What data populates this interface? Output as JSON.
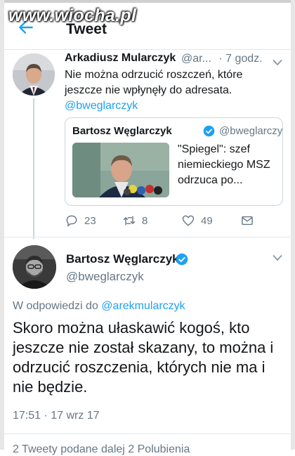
{
  "watermark": "www.wiocha.pl",
  "header": {
    "title": "Tweet",
    "back_icon": "arrow-left-icon"
  },
  "parent_tweet": {
    "name": "Arkadiusz Mularczyk",
    "handle": "@ar...",
    "time": "· 7 godz.",
    "text": "Nie można odrzucić roszczeń, które jeszcze nie wpłynęły do adresata.",
    "mention": "@bweglarczyk",
    "quote": {
      "name": "Bartosz Węglarczyk",
      "handle": "@bweglarczyk",
      "text": "\"Spiegel\": szef niemieckiego MSZ odrzuca po..."
    },
    "actions": {
      "replies": "23",
      "retweets": "8",
      "likes": "49"
    }
  },
  "main_tweet": {
    "name": "Bartosz Węglarczyk",
    "handle": "@bweglarczyk",
    "reply_prefix": "W odpowiedzi do",
    "reply_mention": "@arekmularczyk",
    "text": "Skoro można ułaskawić kogoś, kto jeszcze nie został skazany, to można i odrzucić roszczenia, których nie ma i nie będzie.",
    "time": "17:51 · 17 wrz 17"
  },
  "stats_partial": "2 Tweety podane dalej   2 Polubienia",
  "colors": {
    "accent": "#1da1f2",
    "secondary_text": "#657786",
    "border": "#e1e8ed"
  }
}
